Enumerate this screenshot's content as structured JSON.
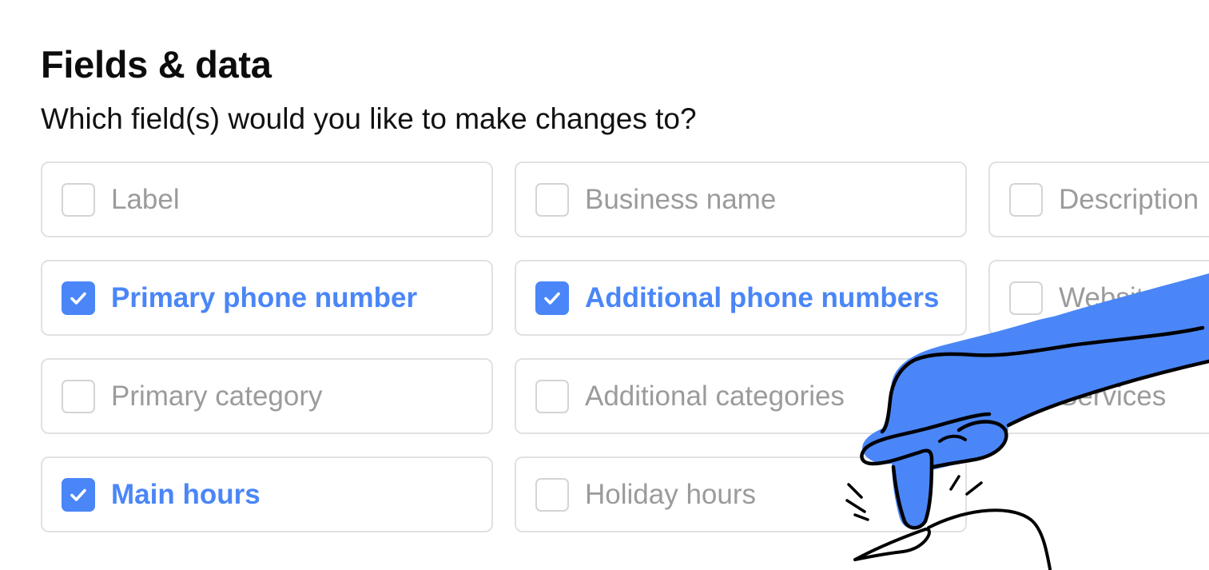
{
  "header": {
    "title": "Fields & data",
    "question": "Which field(s) would you like to make changes to?"
  },
  "fields": [
    {
      "label": "Label",
      "checked": false
    },
    {
      "label": "Business name",
      "checked": false
    },
    {
      "label": "Description",
      "checked": false
    },
    {
      "label": "Primary phone number",
      "checked": true
    },
    {
      "label": "Additional phone numbers",
      "checked": true
    },
    {
      "label": "Website",
      "checked": false
    },
    {
      "label": "Primary category",
      "checked": false
    },
    {
      "label": "Additional categories",
      "checked": false
    },
    {
      "label": "Services",
      "checked": false
    },
    {
      "label": "Main hours",
      "checked": true
    },
    {
      "label": "Holiday hours",
      "checked": false
    }
  ],
  "colors": {
    "accent": "#4a86f7",
    "muted_text": "#9b9b9b",
    "border": "#e1e1e1"
  },
  "illustration": {
    "icon": "pointing-hand-icon"
  }
}
